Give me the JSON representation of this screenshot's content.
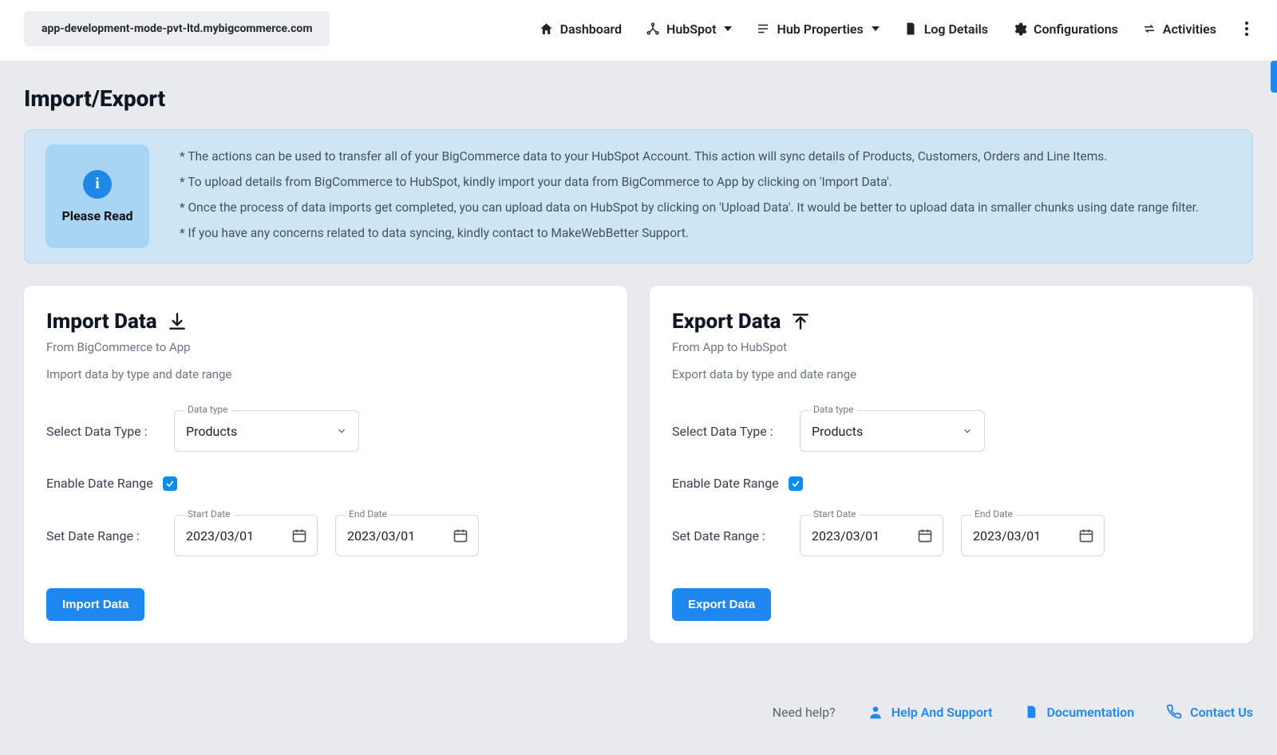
{
  "header": {
    "domain": "app-development-mode-pvt-ltd.mybigcommerce.com",
    "nav": {
      "dashboard": "Dashboard",
      "hubspot": "HubSpot",
      "hub_properties": "Hub Properties",
      "log_details": "Log Details",
      "configurations": "Configurations",
      "activities": "Activities"
    }
  },
  "page": {
    "title": "Import/Export",
    "notice_label": "Please Read",
    "notice_lines": [
      "* The actions can be used to transfer all of your BigCommerce data to your HubSpot Account. This action will sync details of Products, Customers, Orders and Line Items.",
      "* To upload details from BigCommerce to HubSpot, kindly import your data from BigCommerce to App by clicking on 'Import Data'.",
      "* Once the process of data imports get completed, you can upload data on HubSpot by clicking on 'Upload Data'. It would be better to upload data in smaller chunks using date range filter.",
      "* If you have any concerns related to data syncing, kindly contact to MakeWebBetter Support."
    ]
  },
  "import": {
    "title": "Import Data",
    "subtitle": "From BigCommerce to App",
    "description": "Import data by type and date range",
    "select_label": "Select Data Type :",
    "data_type_label": "Data type",
    "data_type_value": "Products",
    "enable_date_range_label": "Enable Date Range",
    "enable_date_range_checked": true,
    "set_date_range_label": "Set Date Range :",
    "start_date_label": "Start Date",
    "start_date_value": "2023/03/01",
    "end_date_label": "End Date",
    "end_date_value": "2023/03/01",
    "button": "Import Data"
  },
  "export": {
    "title": "Export Data",
    "subtitle": "From App to HubSpot",
    "description": "Export data by type and date range",
    "select_label": "Select Data Type :",
    "data_type_label": "Data type",
    "data_type_value": "Products",
    "enable_date_range_label": "Enable Date Range",
    "enable_date_range_checked": true,
    "set_date_range_label": "Set Date Range :",
    "start_date_label": "Start Date",
    "start_date_value": "2023/03/01",
    "end_date_label": "End Date",
    "end_date_value": "2023/03/01",
    "button": "Export Data"
  },
  "footer": {
    "need_help": "Need help?",
    "help_support": "Help And Support",
    "documentation": "Documentation",
    "contact_us": "Contact Us"
  }
}
